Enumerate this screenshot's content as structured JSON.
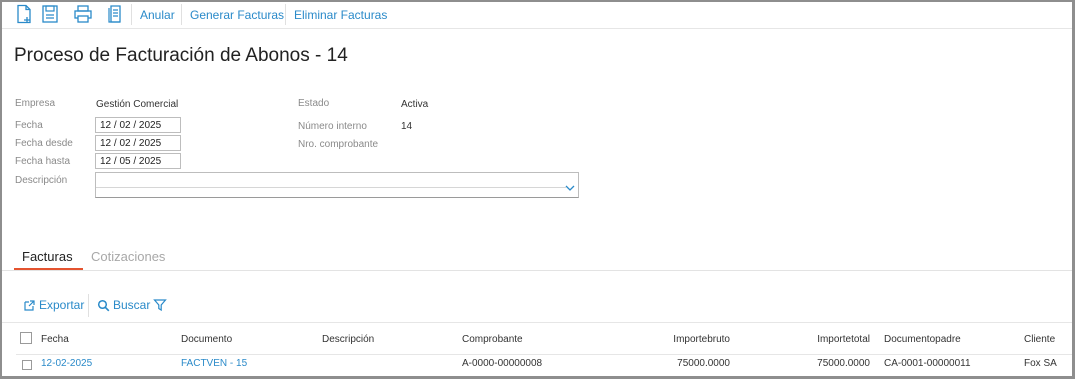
{
  "toolbar": {
    "icons": [
      "new-document-icon",
      "save-icon",
      "print-icon",
      "report-icon"
    ],
    "links": {
      "anular": "Anular",
      "generar": "Generar Facturas",
      "eliminar": "Eliminar Facturas"
    }
  },
  "page": {
    "title": "Proceso de Facturación de Abonos - 14"
  },
  "form": {
    "empresa_label": "Empresa",
    "empresa_value": "Gestión Comercial",
    "fecha_label": "Fecha",
    "fecha_value": "12 / 02 /  2025",
    "fecha_desde_label": "Fecha desde",
    "fecha_desde_value": "12 / 02 /  2025",
    "fecha_hasta_label": "Fecha hasta",
    "fecha_hasta_value": "12 / 05 /  2025",
    "descripcion_label": "Descripción",
    "descripcion_value": "",
    "estado_label": "Estado",
    "estado_value": "Activa",
    "numero_interno_label": "Número interno",
    "numero_interno_value": "14",
    "nro_comprobante_label": "Nro. comprobante",
    "nro_comprobante_value": ""
  },
  "tabs": [
    {
      "label": "Facturas",
      "active": true
    },
    {
      "label": "Cotizaciones",
      "active": false
    }
  ],
  "grid_toolbar": {
    "exportar": "Exportar",
    "buscar": "Buscar"
  },
  "grid": {
    "columns": [
      "Fecha",
      "Documento",
      "Descripción",
      "Comprobante",
      "Importebruto",
      "Importetotal",
      "Documentopadre",
      "Cliente"
    ],
    "rows": [
      {
        "fecha": "12-02-2025",
        "documento": "FACTVEN - 15",
        "descripcion": "",
        "comprobante": "A-0000-00000008",
        "importebruto": "75000.0000",
        "importetotal": "75000.0000",
        "documentopadre": "CA-0001-00000011",
        "cliente": "Fox SA"
      }
    ]
  },
  "colors": {
    "accent": "#2a8ac9",
    "tab_underline": "#e4532f"
  }
}
